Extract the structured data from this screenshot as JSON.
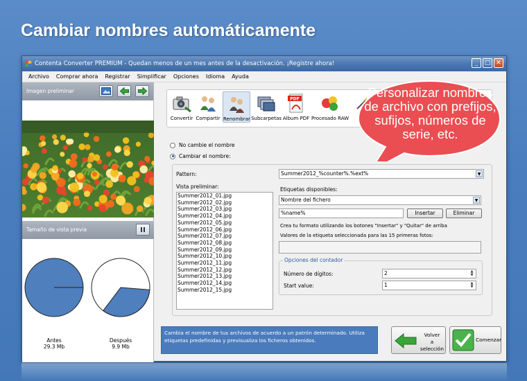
{
  "headline": "Cambiar nombres automáticamente",
  "window": {
    "title": "Contenta Converter PREMIUM  - Quedan menos de un mes antes de la desactivación. ¡Registre ahora!",
    "buttons": {
      "minimize": "_",
      "maximize": "□",
      "close": "✕"
    }
  },
  "menu": [
    "Archivo",
    "Comprar ahora",
    "Registrar",
    "Simplificar",
    "Opciones",
    "Idioma",
    "Ayuda"
  ],
  "left_panel": {
    "preview_title": "Imagen preliminar",
    "preview_size_title": "Tamaño de vista previa",
    "before_label": "Antes",
    "before_size": "29.3 Mb",
    "after_label": "Después",
    "after_size": "9.9 Mb",
    "after_fraction": 0.34
  },
  "toolbar": [
    {
      "label": "Convertir",
      "icon": "camera-icon"
    },
    {
      "label": "Compartir",
      "icon": "people-icon"
    },
    {
      "label": "Renombrar",
      "icon": "rename-people-icon"
    },
    {
      "label": "Subcarpetas",
      "icon": "folders-icon"
    },
    {
      "label": "Album PDF",
      "icon": "pdf-icon",
      "badge": "PDF"
    },
    {
      "label": "Procesado RAW",
      "icon": "raw-balls-icon"
    },
    {
      "label": "",
      "icon": "wand-icon"
    }
  ],
  "options": {
    "no_change": "No cambie el nombre",
    "change": "Cambiar el nombre:"
  },
  "rename": {
    "pattern_label": "Pattern:",
    "pattern_value": "Summer2012_%counter%.%ext%",
    "preview_label": "Vista preliminar:",
    "preview_items": [
      "Summer2012_01.jpg",
      "Summer2012_02.jpg",
      "Summer2012_03.jpg",
      "Summer2012_04.jpg",
      "Summer2012_05.jpg",
      "Summer2012_06.jpg",
      "Summer2012_07.jpg",
      "Summer2012_08.jpg",
      "Summer2012_09.jpg",
      "Summer2012_10.jpg",
      "Summer2012_11.jpg",
      "Summer2012_12.jpg",
      "Summer2012_13.jpg",
      "Summer2012_14.jpg",
      "Summer2012_15.jpg"
    ],
    "tags_label": "Etiquetas disponibles:",
    "tag_selected": "Nombre del fichero",
    "tag_value": "%name%",
    "insert_button": "Insertar",
    "delete_button": "Eliminar",
    "hint": "Crea tu formato utilizando los botones \"Insertar\" y \"Quitar\" de arriba",
    "values_label": "Valores de la etiqueta seleccionada para las 15 primeras fotos:",
    "counter": {
      "legend": "Opciones del contador",
      "digits_label": "Número de dígitos:",
      "digits_value": "2",
      "start_label": "Start value:",
      "start_value": "1"
    }
  },
  "footer": {
    "info": "Cambia el nombre de tus archivos de acuerdo a un patrón determinado. Utiliza etiquetas predefinidas y previsualiza los ficheros obtenidos.",
    "back_button": "Volver\na selección",
    "start_button": "Comenzar"
  },
  "callout": "Personalizar nombres de archivo con prefijos, sufijos, números de serie, etc."
}
